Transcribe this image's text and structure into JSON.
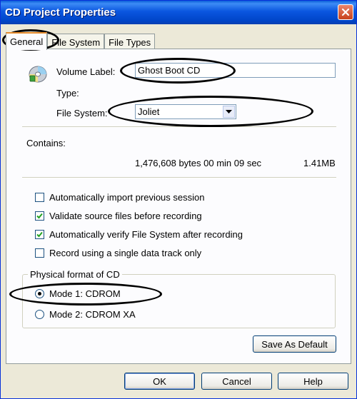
{
  "window": {
    "title": "CD Project Properties"
  },
  "tabs": [
    {
      "label": "General",
      "active": true
    },
    {
      "label": "File System",
      "active": false
    },
    {
      "label": "File Types",
      "active": false
    }
  ],
  "general": {
    "volume_label_label": "Volume Label:",
    "volume_label_value": "Ghost Boot CD",
    "type_label": "Type:",
    "file_system_label": "File System:",
    "file_system_value": "Joliet",
    "contains_label": "Contains:",
    "contains_bytes": "1,476,608 bytes 00 min 09 sec",
    "contains_size": "1.41MB"
  },
  "options": [
    {
      "label": "Automatically import previous session",
      "checked": false
    },
    {
      "label": "Validate source files before recording",
      "checked": true
    },
    {
      "label": "Automatically verify File System after recording",
      "checked": true
    },
    {
      "label": "Record using a single data track only",
      "checked": false
    }
  ],
  "physical_format": {
    "title": "Physical format of CD",
    "options": [
      {
        "label": "Mode 1: CDROM",
        "selected": true
      },
      {
        "label": "Mode 2: CDROM XA",
        "selected": false
      }
    ]
  },
  "buttons": {
    "save_default": "Save As Default",
    "ok": "OK",
    "cancel": "Cancel",
    "help": "Help"
  },
  "colors": {
    "titlebar": "#0a56e0",
    "dialog_bg": "#ece9d8",
    "panel_bg": "#fcfcfe",
    "tab_highlight": "#e68b2c"
  }
}
